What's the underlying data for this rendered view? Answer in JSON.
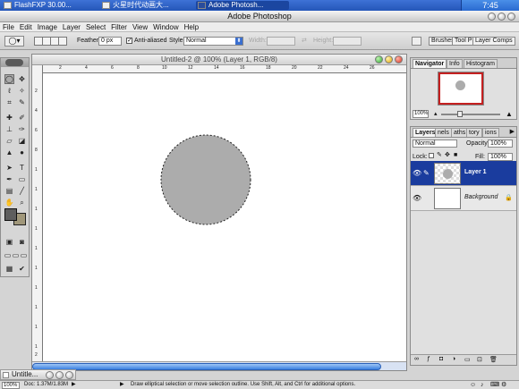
{
  "taskbar": {
    "items": [
      {
        "label": "FlashFXP  30.00...",
        "active": false
      },
      {
        "label": "火星时代动画大...",
        "active": false
      },
      {
        "label": "Adobe Photosh...",
        "active": true
      }
    ],
    "clock": "7:45"
  },
  "window": {
    "title": "Adobe Photoshop"
  },
  "menu": [
    "File",
    "Edit",
    "Image",
    "Layer",
    "Select",
    "Filter",
    "View",
    "Window",
    "Help"
  ],
  "options": {
    "feather_label": "Feather:",
    "feather_value": "0 px",
    "antialias_label": "Anti-aliased",
    "antialias_checked": true,
    "style_label": "Style:",
    "style_value": "Normal",
    "width_label": "Width:",
    "height_label": "Height:",
    "palette_tabs": [
      "Brushes",
      "Tool Pr",
      "Layer Comps"
    ]
  },
  "document": {
    "title": "Untitled-2 @ 100% (Layer 1, RGB/8)",
    "ruler_h": [
      "2",
      "4",
      "6",
      "8",
      "10",
      "12",
      "14",
      "16",
      "18",
      "20",
      "22",
      "24",
      "26"
    ],
    "ruler_v": [
      "2",
      "4",
      "6",
      "8",
      "1",
      "1",
      "1",
      "1",
      "1",
      "1",
      "1",
      "1",
      "1",
      "1",
      "2"
    ],
    "circle_color": "#acacac"
  },
  "navigator": {
    "tabs": [
      "Navigator",
      "Info",
      "Histogram"
    ],
    "zoom": "100%",
    "view_box_color": "#c42020"
  },
  "layers_panel": {
    "tabs": [
      "Layers",
      "nels",
      "aths",
      "tory",
      "ions"
    ],
    "blend_mode": "Normal",
    "opacity_label": "Opacity:",
    "opacity_value": "100%",
    "lock_label": "Lock:",
    "fill_label": "Fill:",
    "fill_value": "100%",
    "layers": [
      {
        "name": "Layer 1",
        "selected": true
      },
      {
        "name": "Background",
        "selected": false
      }
    ],
    "selected_color": "#1a3c9e"
  },
  "minimized_doc": {
    "label": "Untitle..."
  },
  "status": {
    "zoom": "100%",
    "doc_size": "Doc: 1.37M/1.83M",
    "hint": "Draw elliptical selection or move selection outline.  Use Shift, Alt, and Ctrl for additional options."
  }
}
